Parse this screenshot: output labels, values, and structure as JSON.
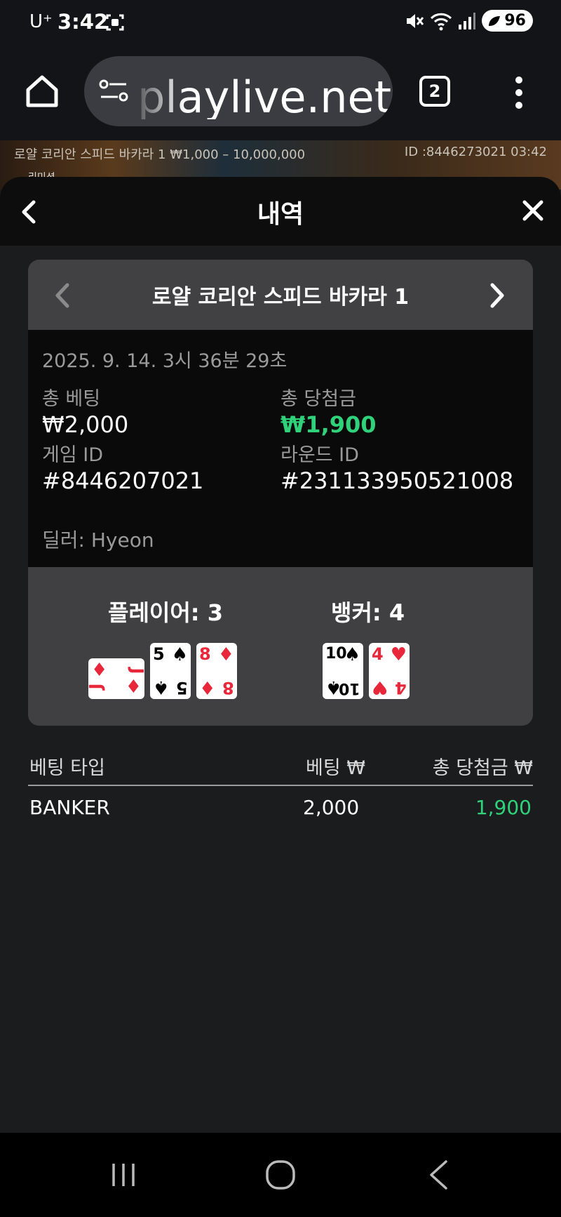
{
  "status": {
    "carrier": "U⁺",
    "time": "3:42",
    "battery": "96"
  },
  "browser": {
    "url": "playlive.net",
    "tab_count": "2"
  },
  "game_strip": {
    "info": "로얄 코리안 스피드 바카라 1 ₩1,000 – 10,000,000",
    "id": "ID :8446273021 03:42",
    "label": "리미셩"
  },
  "modal": {
    "title": "내역"
  },
  "record": {
    "game_name": "로얄 코리안 스피드 바카라 1",
    "datetime": "2025. 9. 14. 3시 36분 29초",
    "total_bet_label": "총 베팅",
    "total_bet_value": "₩2,000",
    "total_win_label": "총 당첨금",
    "total_win_value": "₩1,900",
    "game_id_label": "게임 ID",
    "game_id_value": "#8446207021",
    "round_id_label": "라운드 ID",
    "round_id_value": "#231133950521008",
    "dealer": "딜러: Hyeon"
  },
  "result": {
    "player_title": "플레이어: 3",
    "banker_title": "뱅커: 4",
    "player_cards": [
      {
        "rank": "J",
        "suit": "♦",
        "color": "#e8273a",
        "sideways": true
      },
      {
        "rank": "5",
        "suit": "♠",
        "color": "#000000"
      },
      {
        "rank": "8",
        "suit": "♦",
        "color": "#e8273a"
      }
    ],
    "banker_cards": [
      {
        "rank": "10",
        "suit": "♠",
        "color": "#000000"
      },
      {
        "rank": "4",
        "suit": "♥",
        "color": "#e8273a"
      }
    ]
  },
  "bets_table": {
    "headers": [
      "베팅 타입",
      "베팅 ₩",
      "총 당첨금 ₩"
    ],
    "rows": [
      {
        "type": "BANKER",
        "bet": "2,000",
        "win": "1,900"
      }
    ]
  },
  "colors": {
    "win_green": "#2fd27a",
    "card_red": "#e8273a"
  }
}
